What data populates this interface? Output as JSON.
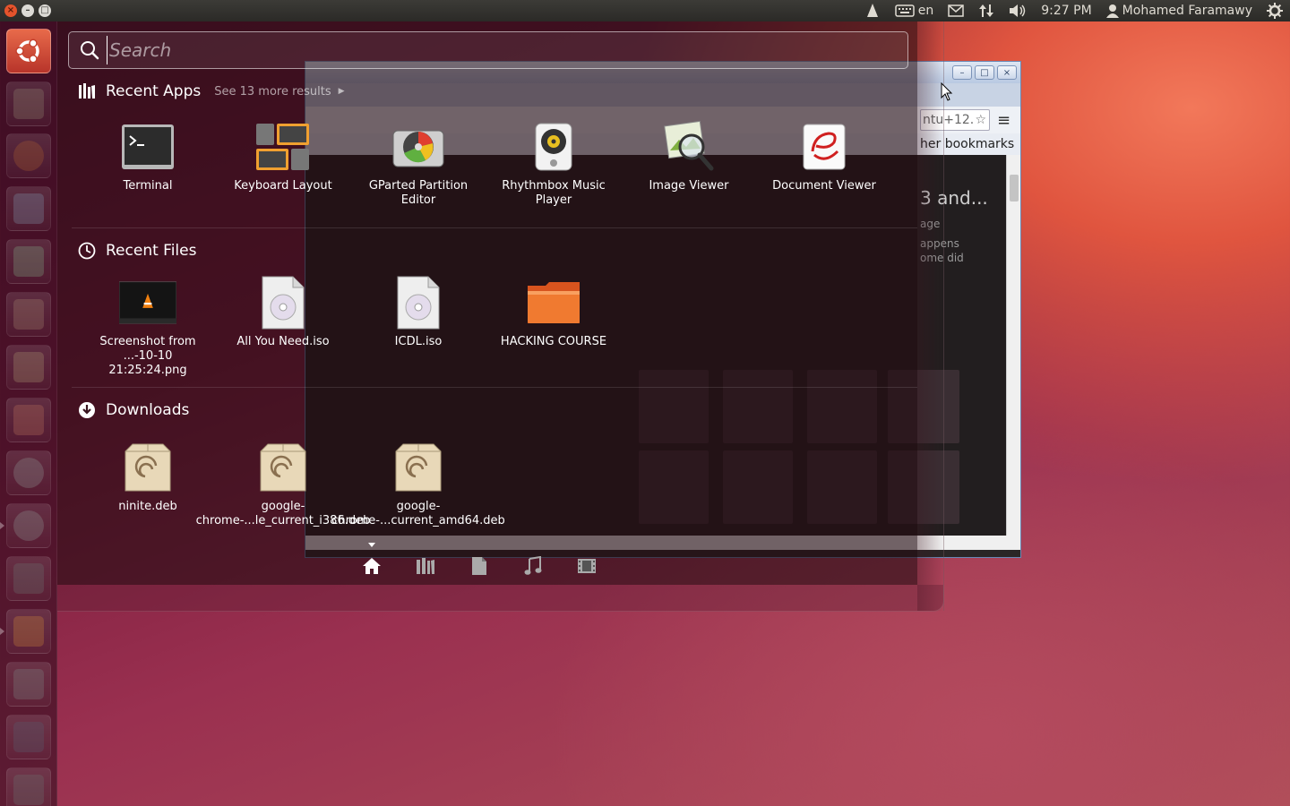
{
  "top_panel": {
    "keyboard_layout": "en",
    "clock": "9:27 PM",
    "user_name": "Mohamed Faramawy"
  },
  "dash": {
    "search": {
      "placeholder": "Search",
      "value": ""
    },
    "recent_apps": {
      "title": "Recent Apps",
      "see_more": "See 13 more results",
      "items": [
        {
          "label": "Terminal",
          "icon": "terminal-icon"
        },
        {
          "label": "Keyboard Layout",
          "icon": "keyboard-layout-icon"
        },
        {
          "label": "GParted Partition Editor",
          "icon": "gparted-icon"
        },
        {
          "label": "Rhythmbox Music Player",
          "icon": "rhythmbox-icon"
        },
        {
          "label": "Image Viewer",
          "icon": "image-viewer-icon"
        },
        {
          "label": "Document Viewer",
          "icon": "document-viewer-icon"
        }
      ]
    },
    "recent_files": {
      "title": "Recent Files",
      "items": [
        {
          "label": "Screenshot from ...-10-10 21:25:24.png",
          "icon": "screenshot-thumbnail"
        },
        {
          "label": "All You Need.iso",
          "icon": "disc-image-icon"
        },
        {
          "label": "ICDL.iso",
          "icon": "disc-image-icon"
        },
        {
          "label": "HACKING COURSE",
          "icon": "folder-icon"
        }
      ]
    },
    "downloads": {
      "title": "Downloads",
      "items": [
        {
          "label": "ninite.deb",
          "icon": "debian-package-icon"
        },
        {
          "label": "google-chrome-...le_current_i386.deb",
          "icon": "debian-package-icon"
        },
        {
          "label": "google-chrome-...current_amd64.deb",
          "icon": "debian-package-icon"
        }
      ]
    },
    "lens_bar": [
      "home-lens",
      "applications-lens",
      "files-lens",
      "music-lens",
      "video-lens"
    ]
  },
  "background_window": {
    "omnibox_text": "ntu+12.",
    "bookmarks_text": "her bookmarks",
    "page_heading": "3 and...",
    "snippet_1": "age",
    "snippet_2": "appens",
    "snippet_3": "ome did"
  },
  "colors": {
    "accent": "#e05a3a",
    "panel": "#3c3b37"
  }
}
